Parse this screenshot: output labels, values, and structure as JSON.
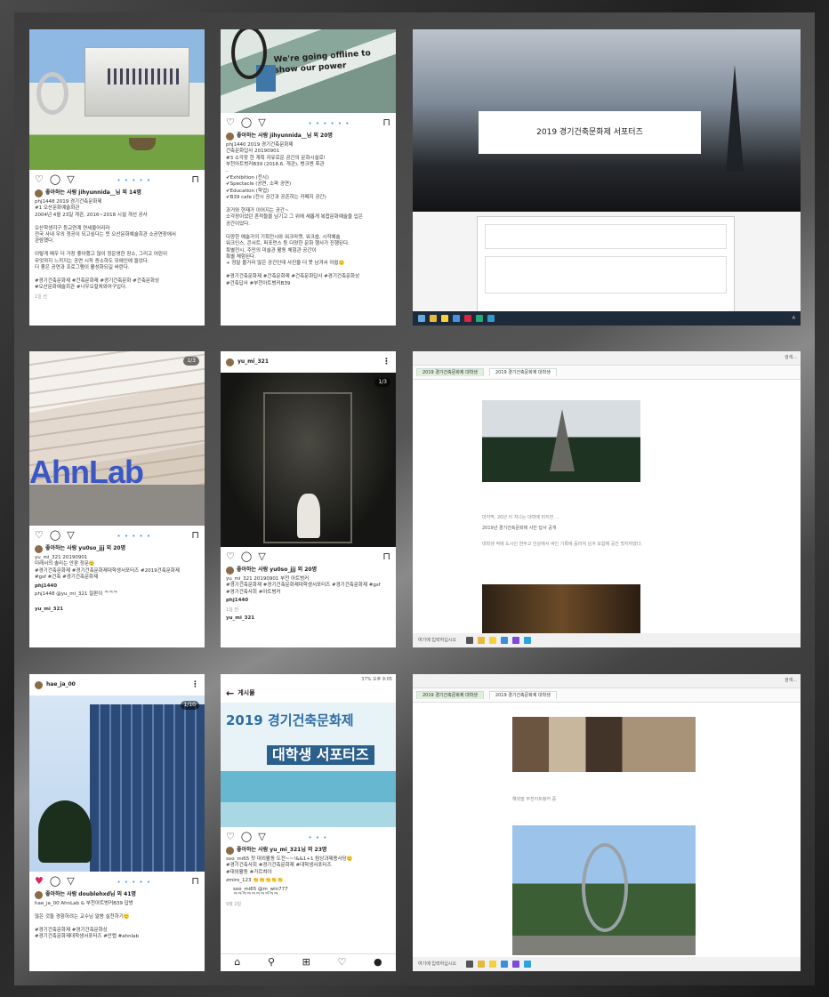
{
  "p1": {
    "dots": "• • • • •",
    "likes": "좋아하는 사람 jihyunnida__님 외 14명",
    "body": "phj1448 2019 경기건축문화제\n#1 오산문화예술회관\n2004년 4월 23일 개관, 2016~2018 시설 개선 공사\n\n오산학생지구 등교연계 연세울어리라\n전국 사내 우의 정공이 되고싶다는 뜻 오산문화예술회관 소공연장에서\n관람했다.\n\n이렇게 매우 더 가장 좋아했고 많이 정운영한 장소, 그리고 어린이\n무엇까지 느끼지는 공연 시작 증소하도 모에인에 들었다.\n더 좋은 공연과 프로그램이 활성화되길 바란다.\n\n#경기건축문화제 #건축문화제 #경기건축문화 #건축문화상\n#오산문화예술회관 #나우오컬쳐와어구입다.",
    "time": "1일 전"
  },
  "p2": {
    "banner": "We're going offline to show our power",
    "dots": "• • • • • •",
    "likes": "좋아하는 사람 jihyunnida__님 외 20명",
    "body": "phj1440 2019 경기건축문화제\n건축문화답사 20190901\n#3 소각장 한 계획 자유로운 공간의 문화시설로!\n부천아트벙커B39 (2018.6. 개관), 벙크엔 후관\n-\n✔Exhibition (전시)\n✔Spectacle (공연, 소파 공연)\n✔Education (학업)\n✔B39 cafe (전시 공간과 공존하는 카페지 공간)\n\n과거와 현재가 이어지는 공간~\n소각장이었던 흔적들을 남기고 그 위에 새롭게 복합문화예술을 입은\n공간이었다.\n\n다양한 예술가의 기획전시와 워크마켓, 워크숍, 시작예술\n워크인스, 콘서트, 퍼포먼스 등 다양한 문화 행사가 진행된다.\n특별전시, 주민의 미술관 활동 체험관 공간이\n특별 체험된다.\n+ 정말 볼거리 많은 공간인데 사진을 더 못 남겨서 아쉽🙂\n\n#경기건축문화제 #건축문화제 #건축문화답사 #경기건축문화상\n#건축답사 #부천아트벙커B39",
    "time": ""
  },
  "b1": {
    "title": "2019 경기건축문화제 서포터즈",
    "tb_text": "A"
  },
  "p3": {
    "badge": "1/3",
    "sign": "AhnLab",
    "dots": "• • • • •",
    "likes": "좋아하는 사람 yu0so_jjj 외 20명",
    "body": "yu_mi_321 20190901\n미래서의 솔리는 안판 정문🙂\n#경기건축문화제 #경기건축문화제대학생서포터즈 #2019건축문화제\n#gsf #건축 #경기건축문화제",
    "comment_user": "phj1440",
    "comment": "phj1448 @yu_mi_321 칠판이 ᄏᄏᄏ",
    "next_user": "yu_mi_321"
  },
  "p4": {
    "user": "yu_mi_321",
    "badge": "1/3",
    "likes": "좋아하는 사람 yu0so_jjj 외 20명",
    "body": "yu_mi_321 20190901 부천 아트벙커\n#경기건축문화제 #경기건축문화제대학생서포터즈 #경기건축문화제 #gsf\n#경기건축사회 #아트벙커",
    "comment_user": "phj1440",
    "time": "1일 전",
    "next_user": "yu_mi_321"
  },
  "b2": {
    "tab1": "2019 경기건축문화제 대학생",
    "tab2": "2019 경기건축문화제 대학생",
    "caption1": "마지막, 20년 이 지나는 대학에 미지한 ...",
    "caption2": "2019년 경기건축문화제 사진 답사 공개",
    "note": "대학생 적에 도시인 연주고 인상에서 싸인 기록에 흘러져 남겨 포함해 공간 멋지하였다.",
    "search": "검색...",
    "tb_text": "여기에 입력하십시오"
  },
  "p5": {
    "user": "hae_ja_00",
    "badge": "1/10",
    "dots": "• • • • •",
    "likes": "좋아하는 사람 doublehxd님 외 41명",
    "body": "hae_ja_00 AhnLab & 부천아트벙커B39 답방\n\n많은 것들 경험하려는 교수님 말씀 실천하기🙂\n\n#경기건축문화제 #경기건축문화상\n#경기건축문화제대학생서포터즈 #안랩 #ahnlab"
  },
  "p6": {
    "status": "37% 오후 9:05",
    "back": "←",
    "title": "게시물",
    "poster1": "2019 경기건축문화제",
    "poster2": "대학생 서포터즈",
    "dots": "• • •",
    "likes": "좋아하는 사람 yu_mi_321님 외 23명",
    "body": "soo_mi65 첫 대외활동 도전~~!&&1+1 탐상과제용사당🙂\n#경기건축사회 #경기건축문화제 #대학생서포터즈\n#대외활동 #가르쳐야",
    "c1": "zmiro_123 👏👏👏👏👏",
    "c2": "soo_mi65 @m_win777\nᄏᄏᄏᄏᄏᄏᄏᄏᄏᄏ",
    "time": "9월 2일"
  },
  "b3": {
    "tab1": "2019 경기건축문화제 대학생",
    "tab2": "2019 경기건축문화제 대학생",
    "search": "검색...",
    "caption": "해외발 부천아트벙커 중",
    "tb_text": "여기에 입력하십시오"
  }
}
